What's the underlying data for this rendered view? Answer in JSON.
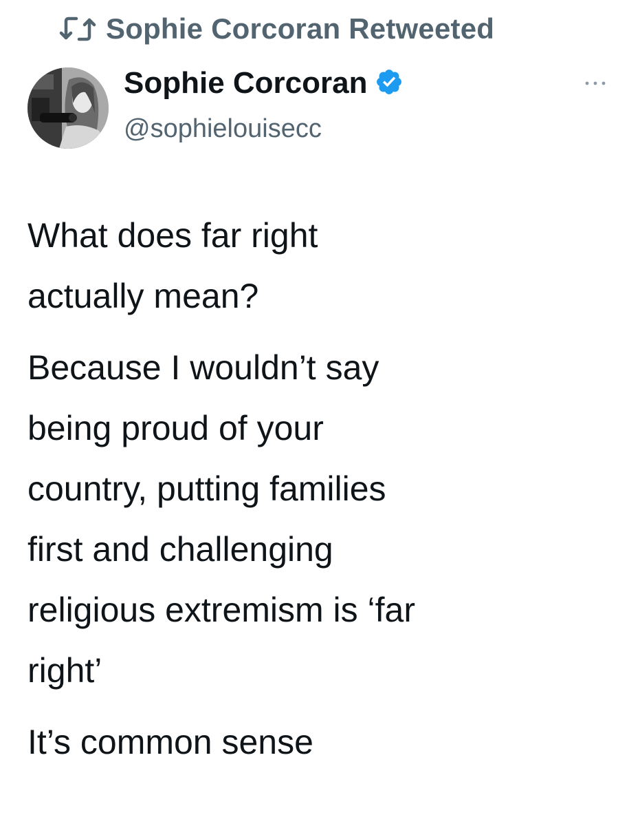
{
  "retweet": {
    "icon": "retweet-icon",
    "text": "Sophie Corcoran Retweeted"
  },
  "author": {
    "name": "Sophie Corcoran",
    "handle": "@sophielouisecc",
    "verified_icon": "verified-badge-icon",
    "avatar": "profile-photo"
  },
  "more_icon": "more-options-icon",
  "tweet": {
    "paragraphs": [
      [
        "What does far right",
        "actually mean?"
      ],
      [
        "Because I wouldn’t say",
        "being proud of your",
        "country, putting families",
        "first and challenging",
        "religious extremism is ‘far",
        "right’"
      ],
      [
        "It’s common sense"
      ]
    ]
  },
  "colors": {
    "text": "#0f1419",
    "secondary": "#536471",
    "verified": "#1d9bf0"
  }
}
